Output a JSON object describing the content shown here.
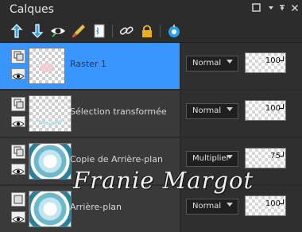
{
  "panel": {
    "title": "Calques",
    "controls": {
      "restore_icon": "square-icon",
      "dropdown_icon": "chevron-down-icon",
      "pin_icon": "pin-icon",
      "close_icon": "close-icon"
    }
  },
  "toolbar": [
    {
      "name": "new-raster-layer-icon"
    },
    {
      "name": "new-vector-layer-icon"
    },
    {
      "name": "visibility-eye-icon"
    },
    {
      "name": "paint-brush-icon"
    },
    {
      "name": "document-page-icon"
    },
    {
      "name": "link-icon"
    },
    {
      "name": "lock-icon"
    },
    {
      "name": "adjust-color-icon"
    }
  ],
  "layers": [
    {
      "name": "Raster 1",
      "blend_mode": "Normal",
      "opacity": "100",
      "selected": true
    },
    {
      "name": "Sélection transformée",
      "blend_mode": "Normal",
      "opacity": "100",
      "selected": false
    },
    {
      "name": "Copie de Arrière-plan",
      "blend_mode": "Multiplier",
      "opacity": "75",
      "selected": false
    },
    {
      "name": "Arrière-plan",
      "blend_mode": "Normal",
      "opacity": "100",
      "selected": false
    }
  ],
  "watermark": "Franie Margot",
  "colors": {
    "selected_row": "#3a96ff",
    "panel_bg": "#2b2b2b",
    "row_bg": "#3a3a3a"
  }
}
